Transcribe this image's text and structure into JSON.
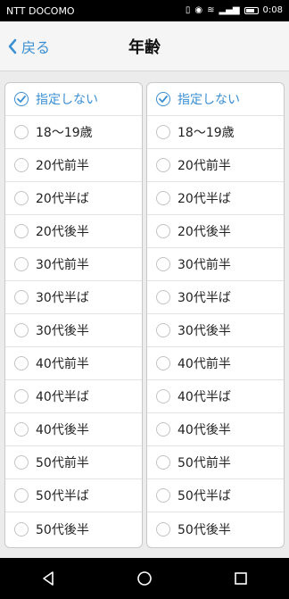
{
  "status_bar": {
    "carrier": "NTT DOCOMO",
    "time": "0:08"
  },
  "header": {
    "back_label": "戻る",
    "title": "年齢"
  },
  "accent_color": "#3b8fd3",
  "left_list": {
    "selected_index": 0,
    "items": [
      "指定しない",
      "18〜19歳",
      "20代前半",
      "20代半ば",
      "20代後半",
      "30代前半",
      "30代半ば",
      "30代後半",
      "40代前半",
      "40代半ば",
      "40代後半",
      "50代前半",
      "50代半ば",
      "50代後半"
    ]
  },
  "right_list": {
    "selected_index": 0,
    "items": [
      "指定しない",
      "18〜19歳",
      "20代前半",
      "20代半ば",
      "20代後半",
      "30代前半",
      "30代半ば",
      "30代後半",
      "40代前半",
      "40代半ば",
      "40代後半",
      "50代前半",
      "50代半ば",
      "50代後半"
    ]
  },
  "nav": {
    "icons": [
      "back-triangle-icon",
      "home-circle-icon",
      "recents-square-icon"
    ]
  }
}
